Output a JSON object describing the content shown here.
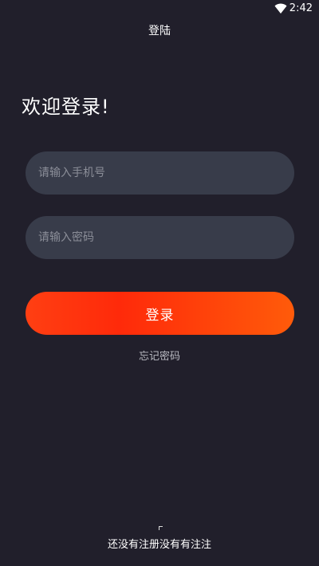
{
  "status_bar": {
    "time": "2:42",
    "wifi_icon": "wifi-icon"
  },
  "nav": {
    "title": "登陆"
  },
  "welcome": {
    "text": "欢迎登录!"
  },
  "phone_field": {
    "placeholder": "请输入手机号",
    "value": ""
  },
  "password_field": {
    "placeholder": "请输入密码",
    "value": ""
  },
  "login_button": {
    "label": "登录"
  },
  "forgot_password": {
    "label": "忘记密码"
  },
  "register": {
    "text": "还没有注册没有有注注"
  },
  "colors": {
    "background": "#211f2b",
    "field_background": "#383c4a",
    "placeholder": "#8b8e98",
    "button_gradient_start": "#ff3f12",
    "button_gradient_end": "#ff5b0a"
  }
}
